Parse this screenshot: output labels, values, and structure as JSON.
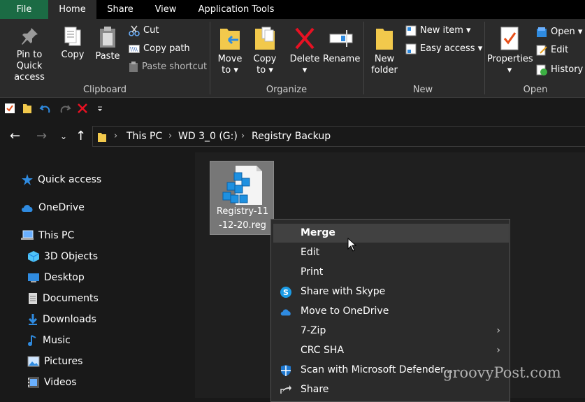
{
  "tabs": {
    "file": "File",
    "home": "Home",
    "share": "Share",
    "view": "View",
    "app_tools": "Application Tools"
  },
  "ribbon": {
    "clipboard": {
      "label": "Clipboard",
      "pin": "Pin to Quick access",
      "copy": "Copy",
      "paste": "Paste",
      "cut": "Cut",
      "copy_path": "Copy path",
      "paste_shortcut": "Paste shortcut"
    },
    "organize": {
      "label": "Organize",
      "move_to": "Move to",
      "copy_to": "Copy to",
      "delete": "Delete",
      "rename": "Rename"
    },
    "new": {
      "label": "New",
      "new_folder": "New folder",
      "new_item": "New item",
      "easy_access": "Easy access"
    },
    "open": {
      "label": "Open",
      "properties": "Properties",
      "open": "Open",
      "edit": "Edit",
      "history": "History"
    }
  },
  "breadcrumb": [
    "This PC",
    "WD 3_0 (G:)",
    "Registry Backup"
  ],
  "nav": {
    "quick_access": "Quick access",
    "onedrive": "OneDrive",
    "this_pc": "This PC",
    "objects_3d": "3D Objects",
    "desktop": "Desktop",
    "documents": "Documents",
    "downloads": "Downloads",
    "music": "Music",
    "pictures": "Pictures",
    "videos": "Videos"
  },
  "file": {
    "name_line1": "Registry-11",
    "name_line2": "-12-20.reg"
  },
  "context_menu": {
    "merge": "Merge",
    "edit": "Edit",
    "print": "Print",
    "share_skype": "Share with Skype",
    "move_onedrive": "Move to OneDrive",
    "zip": "7-Zip",
    "crc": "CRC SHA",
    "scan": "Scan with Microsoft Defender...",
    "share": "Share"
  },
  "watermark": "groovyPost.com",
  "colors": {
    "file_tab": "#1b6b44",
    "folder": "#f2c94c",
    "onedrive": "#2f8be0",
    "delete": "#e81123"
  }
}
